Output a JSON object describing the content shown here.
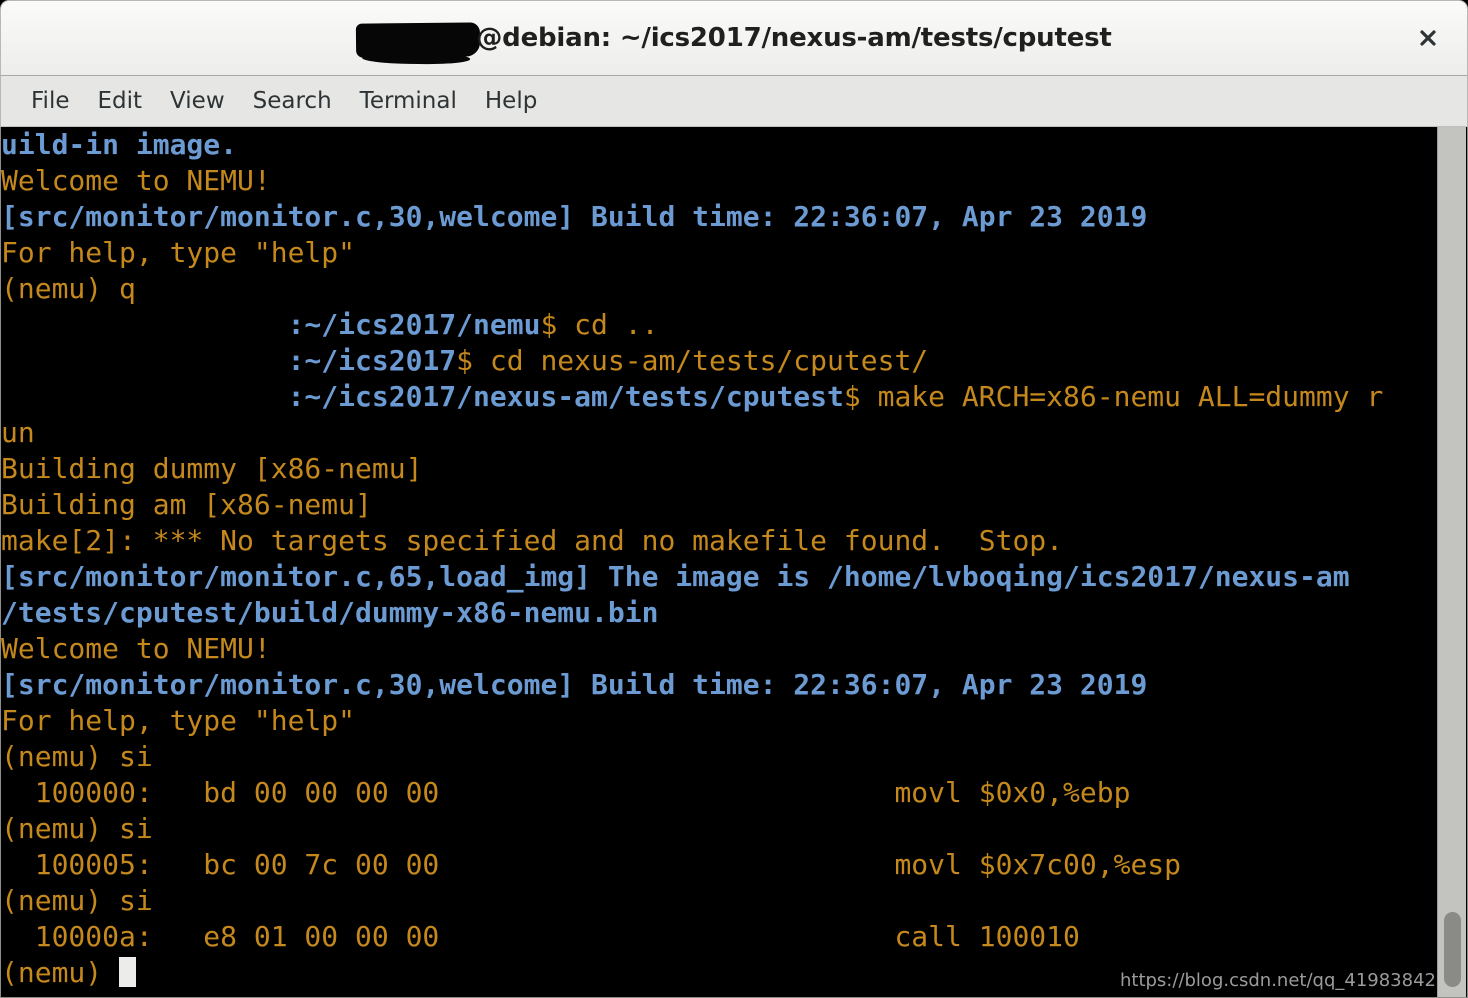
{
  "window": {
    "title_redacted_user": true,
    "title": "@debian: ~/ics2017/nexus-am/tests/cputest",
    "close_icon": "close-icon"
  },
  "menubar": {
    "items": [
      {
        "label": "File"
      },
      {
        "label": "Edit"
      },
      {
        "label": "View"
      },
      {
        "label": "Search"
      },
      {
        "label": "Terminal"
      },
      {
        "label": "Help"
      }
    ]
  },
  "terminal": {
    "lines": [
      {
        "id": "l01",
        "color": "blue",
        "text": "uild-in image."
      },
      {
        "id": "l02",
        "color": "orange",
        "text": "Welcome to NEMU!"
      },
      {
        "id": "l03",
        "color": "blue",
        "text": "[src/monitor/monitor.c,30,welcome] Build time: 22:36:07, Apr 23 2019"
      },
      {
        "id": "l04",
        "color": "orange",
        "text": "For help, type \"help\""
      },
      {
        "id": "l05",
        "color": "orange",
        "text": "(nemu) q"
      },
      {
        "id": "l06",
        "color": "mixed",
        "redacted": "                 ",
        "path": ":~/ics2017/nemu",
        "cmd": "$ cd .."
      },
      {
        "id": "l07",
        "color": "mixed",
        "redacted": "                 ",
        "path": ":~/ics2017",
        "cmd": "$ cd nexus-am/tests/cputest/"
      },
      {
        "id": "l08",
        "color": "mixed",
        "redacted": "                 ",
        "path": ":~/ics2017/nexus-am/tests/cputest",
        "cmd": "$ make ARCH=x86-nemu ALL=dummy r"
      },
      {
        "id": "l09",
        "color": "orange",
        "text": "un"
      },
      {
        "id": "l10",
        "color": "orange",
        "text": "Building dummy [x86-nemu]"
      },
      {
        "id": "l11",
        "color": "orange",
        "text": "Building am [x86-nemu]"
      },
      {
        "id": "l12",
        "color": "orange",
        "text": "make[2]: *** No targets specified and no makefile found.  Stop."
      },
      {
        "id": "l13",
        "color": "blue",
        "text": "[src/monitor/monitor.c,65,load_img] The image is /home/lvboqing/ics2017/nexus-am"
      },
      {
        "id": "l14",
        "color": "blue",
        "text": "/tests/cputest/build/dummy-x86-nemu.bin"
      },
      {
        "id": "l15",
        "color": "orange",
        "text": "Welcome to NEMU!"
      },
      {
        "id": "l16",
        "color": "blue",
        "text": "[src/monitor/monitor.c,30,welcome] Build time: 22:36:07, Apr 23 2019"
      },
      {
        "id": "l17",
        "color": "orange",
        "text": "For help, type \"help\""
      },
      {
        "id": "l18",
        "color": "orange",
        "text": "(nemu) si"
      },
      {
        "id": "l19",
        "color": "orange",
        "text": "  100000:   bd 00 00 00 00                           movl $0x0,%ebp"
      },
      {
        "id": "l20",
        "color": "orange",
        "text": "(nemu) si"
      },
      {
        "id": "l21",
        "color": "orange",
        "text": "  100005:   bc 00 7c 00 00                           movl $0x7c00,%esp"
      },
      {
        "id": "l22",
        "color": "orange",
        "text": "(nemu) si"
      },
      {
        "id": "l23",
        "color": "orange",
        "text": "  10000a:   e8 01 00 00 00                           call 100010"
      },
      {
        "id": "l24",
        "color": "orange",
        "text": "(nemu) ",
        "cursor": true
      }
    ],
    "colors": {
      "background": "#000000",
      "orange": "#c4881c",
      "blue": "#6b9bd2",
      "cursor": "#ececeb"
    }
  },
  "scrollbar": {
    "track_color": "#c3c3c0",
    "thumb_color": "#8a8a87"
  },
  "watermark": {
    "text": "https://blog.csdn.net/qq_41983842"
  }
}
